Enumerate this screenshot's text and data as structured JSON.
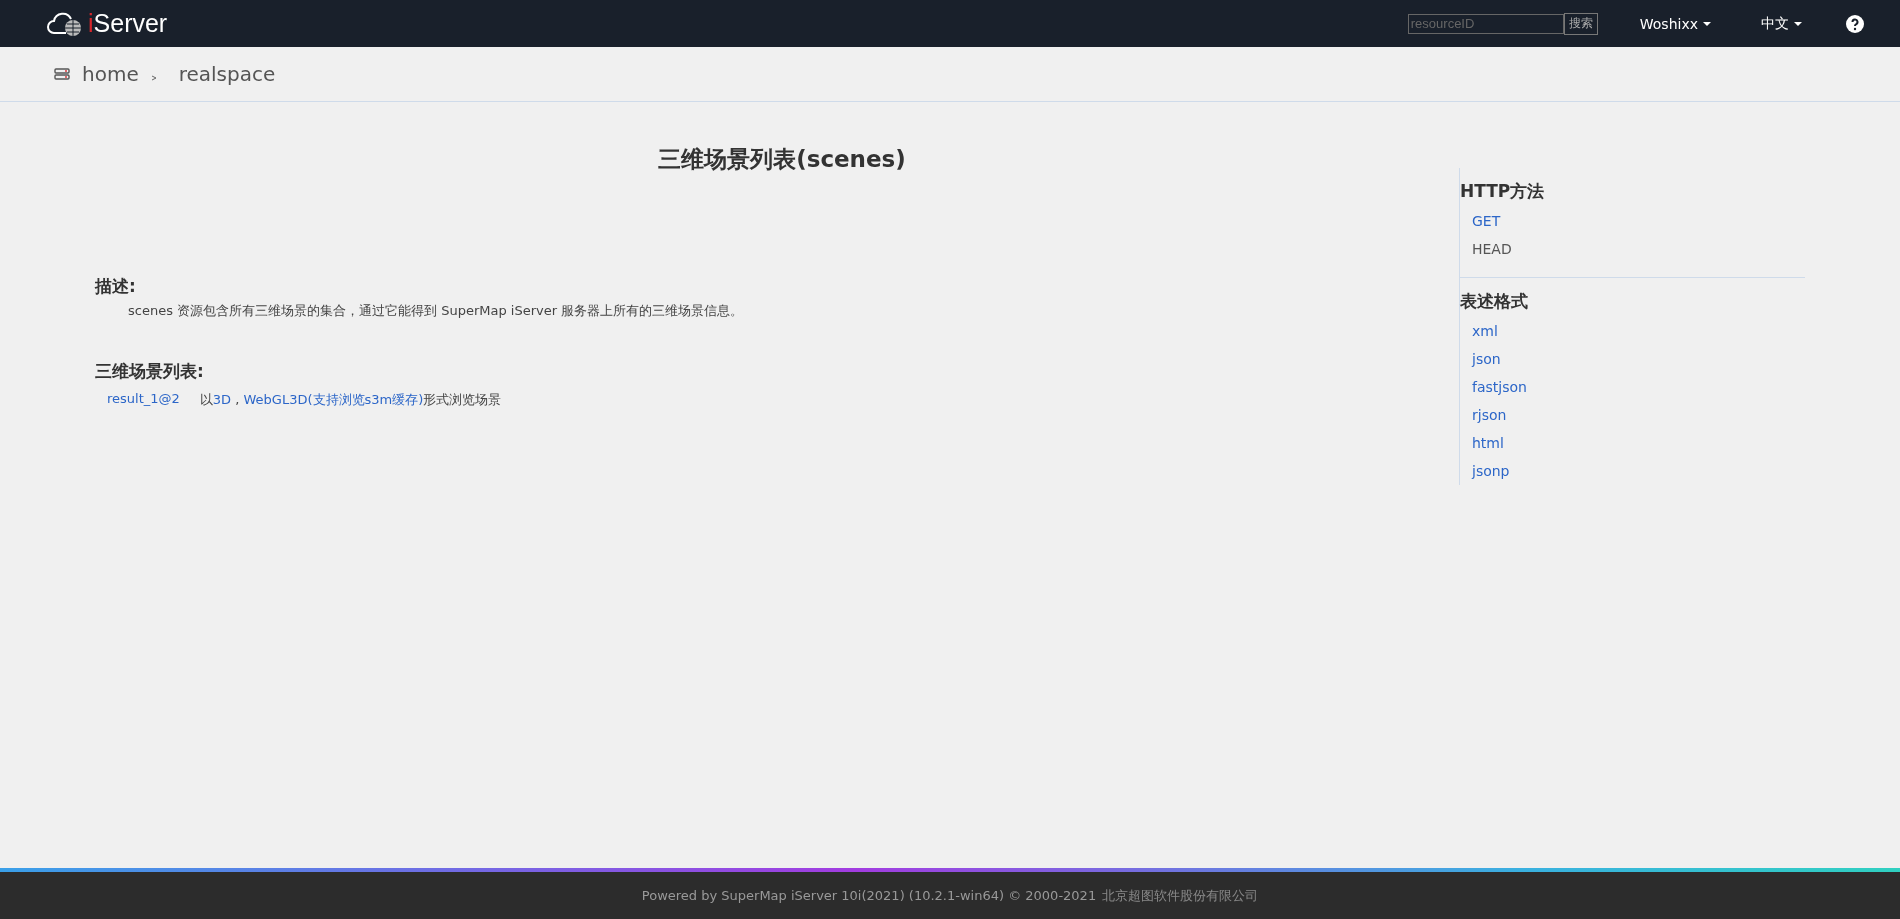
{
  "header": {
    "logo": "iServer",
    "search": {
      "placeholder": "resourceID",
      "button": "搜索"
    },
    "user": "Woshixx",
    "language": "中文"
  },
  "breadcrumb": [
    "home",
    "realspace"
  ],
  "title": "三维场景列表(scenes)",
  "description": {
    "heading": "描述:",
    "text": "scenes 资源包含所有三维场景的集合，通过它能得到 SuperMap iServer 服务器上所有的三维场景信息。"
  },
  "scene_list": {
    "heading": "三维场景列表:",
    "items": [
      {
        "name": "result_1@2",
        "segments": [
          {
            "kind": "text",
            "text": "以"
          },
          {
            "kind": "link",
            "text": "3D"
          },
          {
            "kind": "text",
            "text": " , "
          },
          {
            "kind": "link",
            "text": "WebGL3D(支持浏览s3m缓存)"
          },
          {
            "kind": "text",
            "text": "形式浏览场景"
          }
        ]
      }
    ]
  },
  "sidebar": {
    "methods_heading": "HTTP方法",
    "methods": [
      {
        "label": "GET",
        "disabled": false
      },
      {
        "label": "HEAD",
        "disabled": true
      }
    ],
    "formats_heading": "表述格式",
    "formats": [
      "xml",
      "json",
      "fastjson",
      "rjson",
      "html",
      "jsonp"
    ]
  },
  "footer": {
    "text": "Powered by SuperMap iServer 10i(2021) (10.2.1-win64) © 2000-2021",
    "company": "北京超图软件股份有限公司"
  }
}
